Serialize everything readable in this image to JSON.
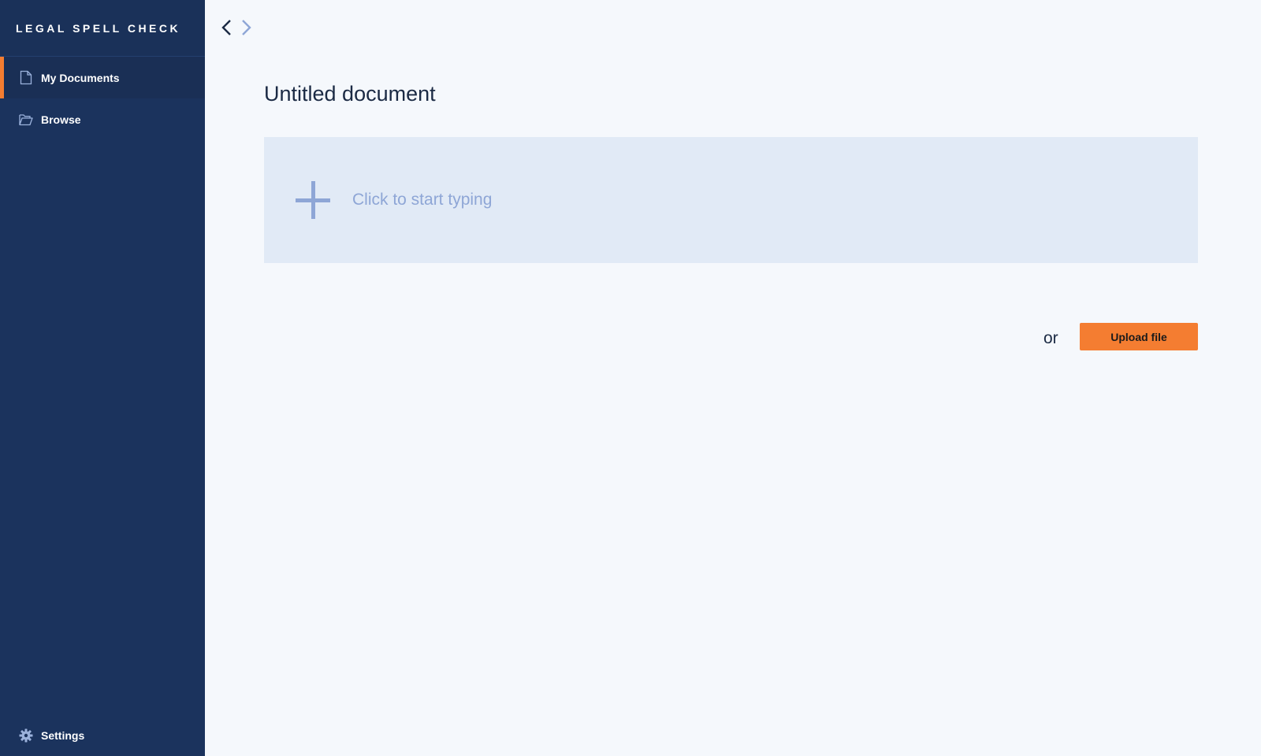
{
  "sidebar": {
    "brand": "LEGAL SPELL CHECK",
    "items": [
      {
        "label": "My Documents",
        "icon": "document-icon",
        "active": true
      },
      {
        "label": "Browse",
        "icon": "folder-icon",
        "active": false
      }
    ],
    "settings_label": "Settings"
  },
  "history": {
    "back_icon": "chevron-left-icon",
    "forward_icon": "chevron-right-icon"
  },
  "main": {
    "title": "Untitled document",
    "typing_placeholder": "Click to start typing",
    "or_text": "or",
    "upload_label": "Upload file"
  },
  "colors": {
    "sidebar_bg": "#1b335d",
    "accent": "#f47d31",
    "page_bg": "#f5f8fc",
    "typing_area_bg": "#e1eaf6",
    "placeholder": "#8ea6d6"
  }
}
